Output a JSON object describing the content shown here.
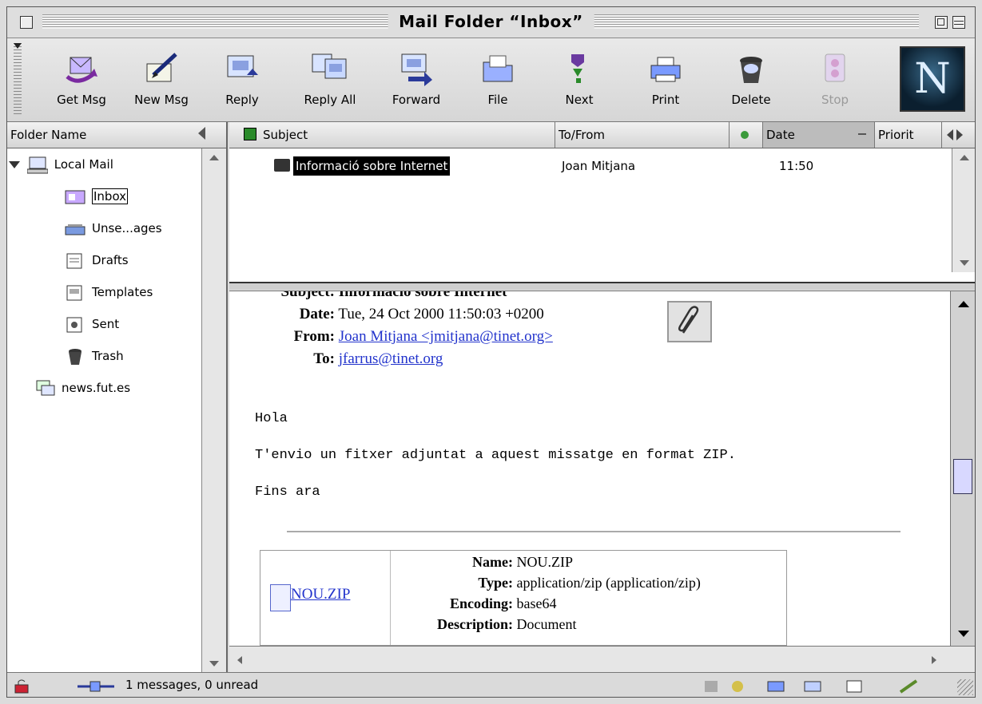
{
  "window": {
    "title": "Mail Folder “Inbox”"
  },
  "toolbar": {
    "buttons": [
      {
        "label": "Get Msg"
      },
      {
        "label": "New Msg"
      },
      {
        "label": "Reply"
      },
      {
        "label": "Reply All"
      },
      {
        "label": "Forward"
      },
      {
        "label": "File"
      },
      {
        "label": "Next"
      },
      {
        "label": "Print"
      },
      {
        "label": "Delete"
      },
      {
        "label": "Stop"
      }
    ],
    "logo_letter": "N"
  },
  "folders": {
    "header": "Folder Name",
    "items": [
      {
        "label": "Local Mail"
      },
      {
        "label": "Inbox"
      },
      {
        "label": "Unse...ages"
      },
      {
        "label": "Drafts"
      },
      {
        "label": "Templates"
      },
      {
        "label": "Sent"
      },
      {
        "label": "Trash"
      },
      {
        "label": "news.fut.es"
      }
    ]
  },
  "message_list": {
    "columns": {
      "subject": "Subject",
      "tofrom": "To/From",
      "date": "Date",
      "priority": "Priorit"
    },
    "rows": [
      {
        "subject": "Informació sobre Internet",
        "tofrom": "Joan Mitjana",
        "date": "11:50"
      }
    ]
  },
  "message": {
    "subject_label": "Subject:",
    "subject": "Informació sobre Internet",
    "date_label": "Date:",
    "date": "Tue, 24 Oct 2000 11:50:03 +0200",
    "from_label": "From:",
    "from": "Joan Mitjana <jmitjana@tinet.org>",
    "to_label": "To:",
    "to": "jfarrus@tinet.org",
    "body": [
      "Hola",
      "T'envio un fitxer adjuntat a aquest missatge en format ZIP.",
      "Fins ara"
    ],
    "attachment": {
      "link": "NOU.ZIP",
      "name_label": "Name:",
      "name": "NOU.ZIP",
      "type_label": "Type:",
      "type": "application/zip (application/zip)",
      "encoding_label": "Encoding:",
      "encoding": "base64",
      "description_label": "Description:",
      "description": "Document"
    }
  },
  "status": {
    "text": "1 messages, 0 unread"
  }
}
